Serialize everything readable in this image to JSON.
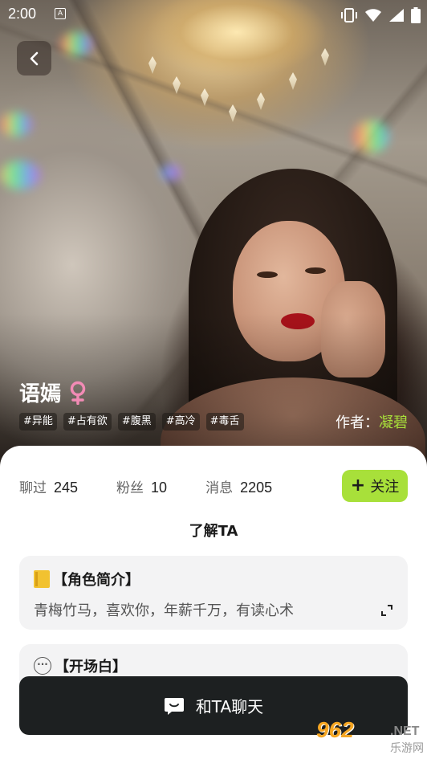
{
  "status_bar": {
    "time": "2:00",
    "app_badge": "A"
  },
  "character": {
    "name": "语嫣",
    "gender": "female",
    "tags": [
      "#异能",
      "#占有欲",
      "#腹黑",
      "#高冷",
      "#毒舌"
    ],
    "author_label": "作者：",
    "author_name": "凝碧"
  },
  "stats": [
    {
      "label": "聊过",
      "value": "245"
    },
    {
      "label": "粉丝",
      "value": "10"
    },
    {
      "label": "消息",
      "value": "2205"
    }
  ],
  "follow_button": {
    "icon": "plus-icon",
    "label": "关注"
  },
  "section_title": "了解TA",
  "intro": {
    "heading": "【角色简介】",
    "text": "青梅竹马，喜欢你，年薪千万，有读心术"
  },
  "opening": {
    "heading": "【开场白】"
  },
  "chat_button": {
    "label": "和TA聊天"
  },
  "watermark": {
    "main": "962",
    "net": ".NET",
    "sub": "乐游网"
  },
  "colors": {
    "accent": "#a8e03a",
    "dark_button": "#1d2021",
    "box_bg": "#f3f3f4",
    "gender_icon": "#f28bb5"
  }
}
